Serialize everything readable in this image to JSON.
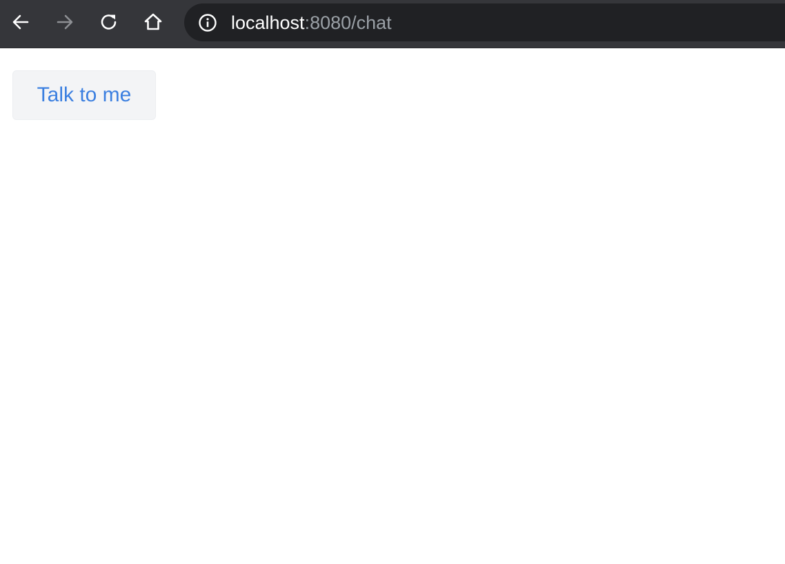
{
  "browser": {
    "nav_icons": {
      "back": "back-arrow-icon",
      "forward": "forward-arrow-icon",
      "reload": "reload-icon",
      "home": "home-icon",
      "site_info": "info-icon"
    },
    "address": {
      "host": "localhost",
      "rest": ":8080/chat"
    }
  },
  "page": {
    "talk_button_label": "Talk to me"
  },
  "colors": {
    "toolbar_bg": "#35363a",
    "omnibox_bg": "#202124",
    "button_text": "#3b7fe0",
    "button_bg": "#f3f4f6"
  }
}
